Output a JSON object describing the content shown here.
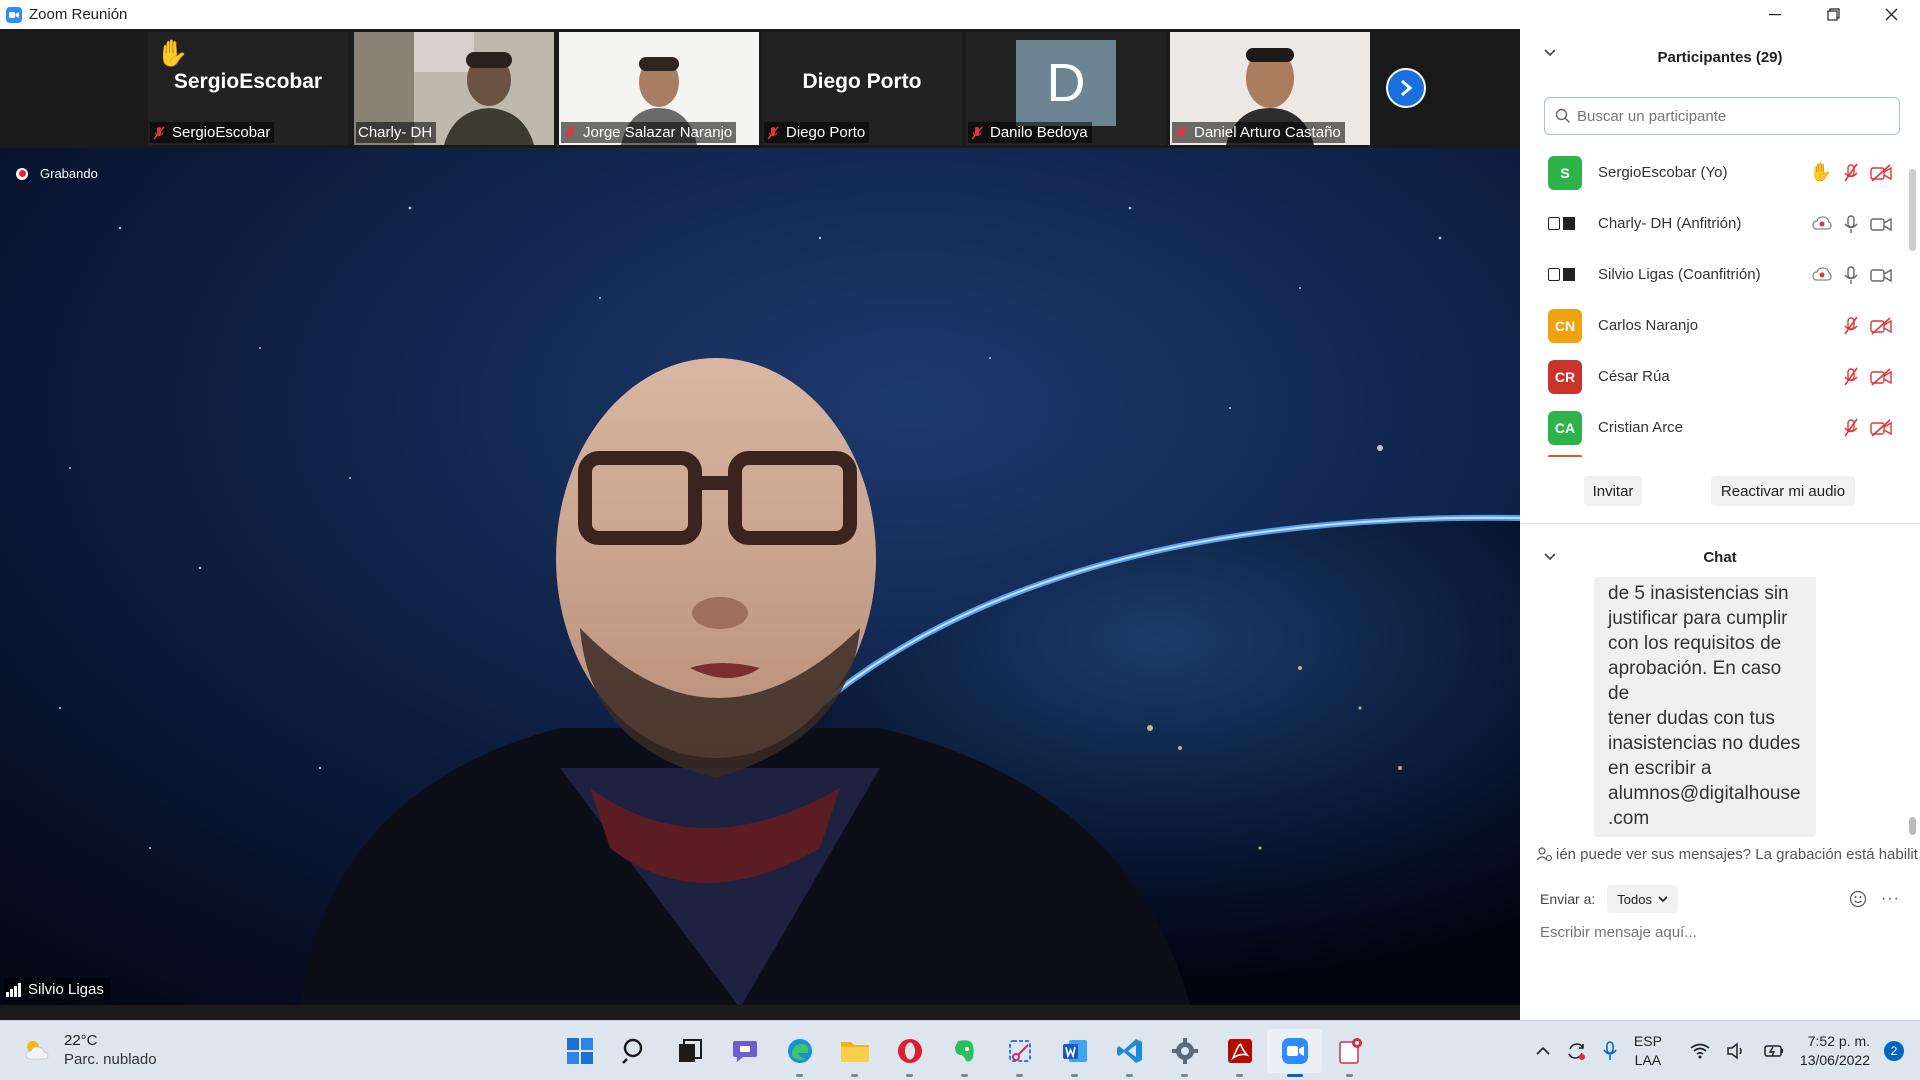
{
  "window": {
    "title": "Zoom Reunión"
  },
  "gallery": {
    "tiles": [
      {
        "display_name": "SergioEscobar",
        "label": "SergioEscobar"
      },
      {
        "label": "Charly- DH"
      },
      {
        "label": "Jorge Salazar Naranjo"
      },
      {
        "display_name": "Diego Porto",
        "label": "Diego Porto"
      },
      {
        "avatar_letter": "D",
        "label": "Danilo Bedoya"
      },
      {
        "label": "Daniel Arturo Castaño"
      }
    ]
  },
  "main_video": {
    "recording_label": "Grabando",
    "speaker_name": "Silvio Ligas"
  },
  "participants_panel": {
    "title": "Participantes (29)",
    "search_placeholder": "Buscar un participante",
    "participants": [
      {
        "initials": "S",
        "color": "#2eb24a",
        "name": "SergioEscobar (Yo)"
      },
      {
        "initials": "",
        "name": "Charly- DH (Anfitrión)"
      },
      {
        "initials": "",
        "name": "Silvio Ligas (Coanfitrión)"
      },
      {
        "initials": "CN",
        "color": "#f0a20e",
        "name": "Carlos Naranjo"
      },
      {
        "initials": "CR",
        "color": "#c9332b",
        "name": "César Rúa"
      },
      {
        "initials": "CA",
        "color": "#2eb24a",
        "name": "Cristian Arce"
      }
    ],
    "invite_button": "Invitar",
    "unmute_button": "Reactivar mi audio"
  },
  "chat": {
    "title": "Chat",
    "message": "de 5 inasistencias sin\njustificar para cumplir\ncon los requisitos de\naprobación. En caso de\ntener dudas con tus\ninasistencias no dudes\nen escribir a\nalumnos@digitalhouse\n.com",
    "notice": "ién puede ver sus mensajes? La grabación está habilit",
    "send_to_label": "Enviar a:",
    "send_to_value": "Todos",
    "input_placeholder": "Escribir mensaje aquí..."
  },
  "taskbar": {
    "weather_temp": "22°C",
    "weather_desc": "Parc. nublado",
    "lang_line1": "ESP",
    "lang_line2": "LAA",
    "time": "7:52 p. m.",
    "date": "13/06/2022",
    "notification_count": "2"
  }
}
